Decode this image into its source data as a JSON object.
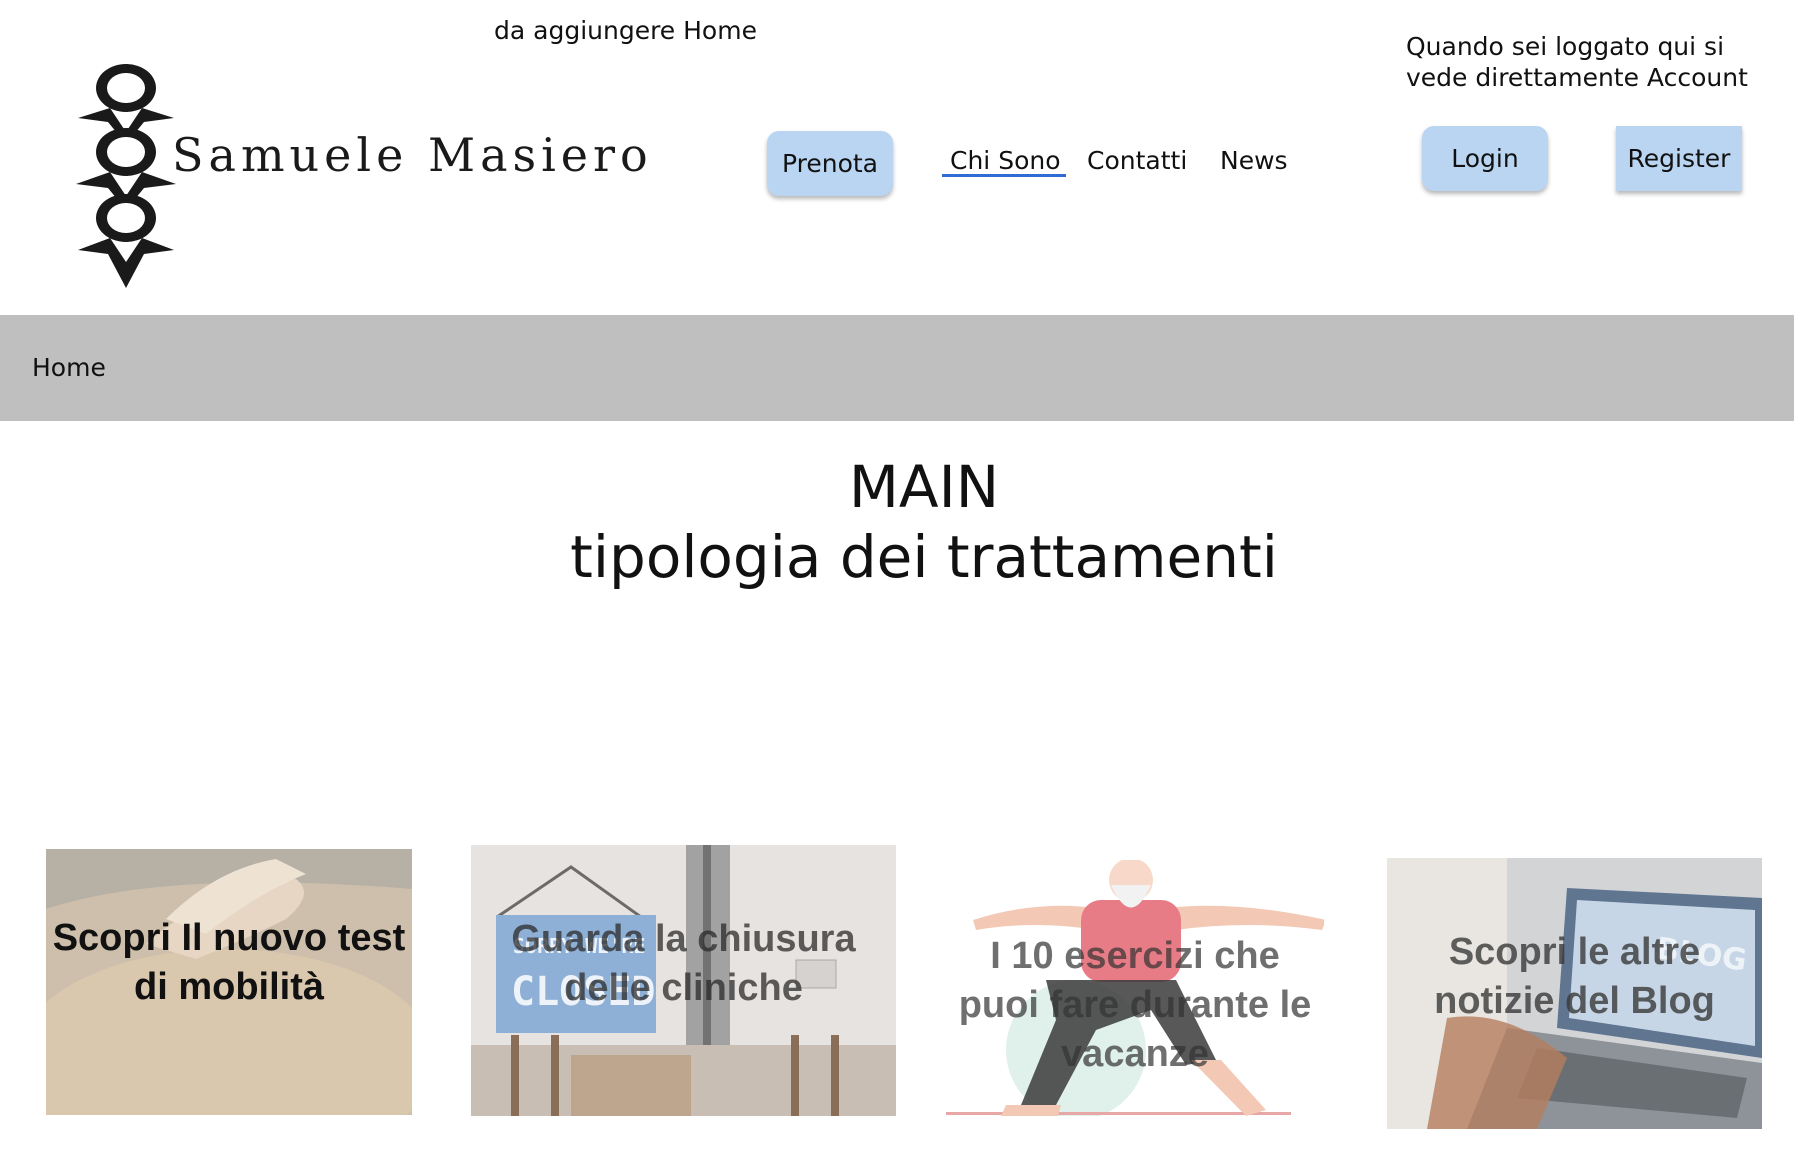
{
  "notes": {
    "top": "da aggiungere Home",
    "right": "Quando sei loggato qui si\nvede direttamente Account"
  },
  "brand": {
    "name": "Samuele Masiero"
  },
  "nav": {
    "prenota": "Prenota",
    "chi_sono": "Chi Sono",
    "contatti": "Contatti",
    "news": "News",
    "login": "Login",
    "register": "Register"
  },
  "breadcrumb": {
    "home": "Home"
  },
  "main": {
    "title": "MAIN",
    "subtitle": "tipologia dei trattamenti"
  },
  "cards": [
    {
      "title": "Scopri Il nuovo test di mobilità"
    },
    {
      "title": "Guarda  la chiusura delle cliniche",
      "sign_top": "SORRY WE'RE",
      "sign_bottom": "CLOSED"
    },
    {
      "title": "I 10 esercizi che puoi fare durante le vacanze"
    },
    {
      "title": "Scopri le altre notizie del Blog",
      "screen_word": "BLOG"
    }
  ],
  "colors": {
    "button_bg": "#b9d5f2",
    "band_bg": "#bfbfbf",
    "active_underline": "#2f6bd4"
  }
}
